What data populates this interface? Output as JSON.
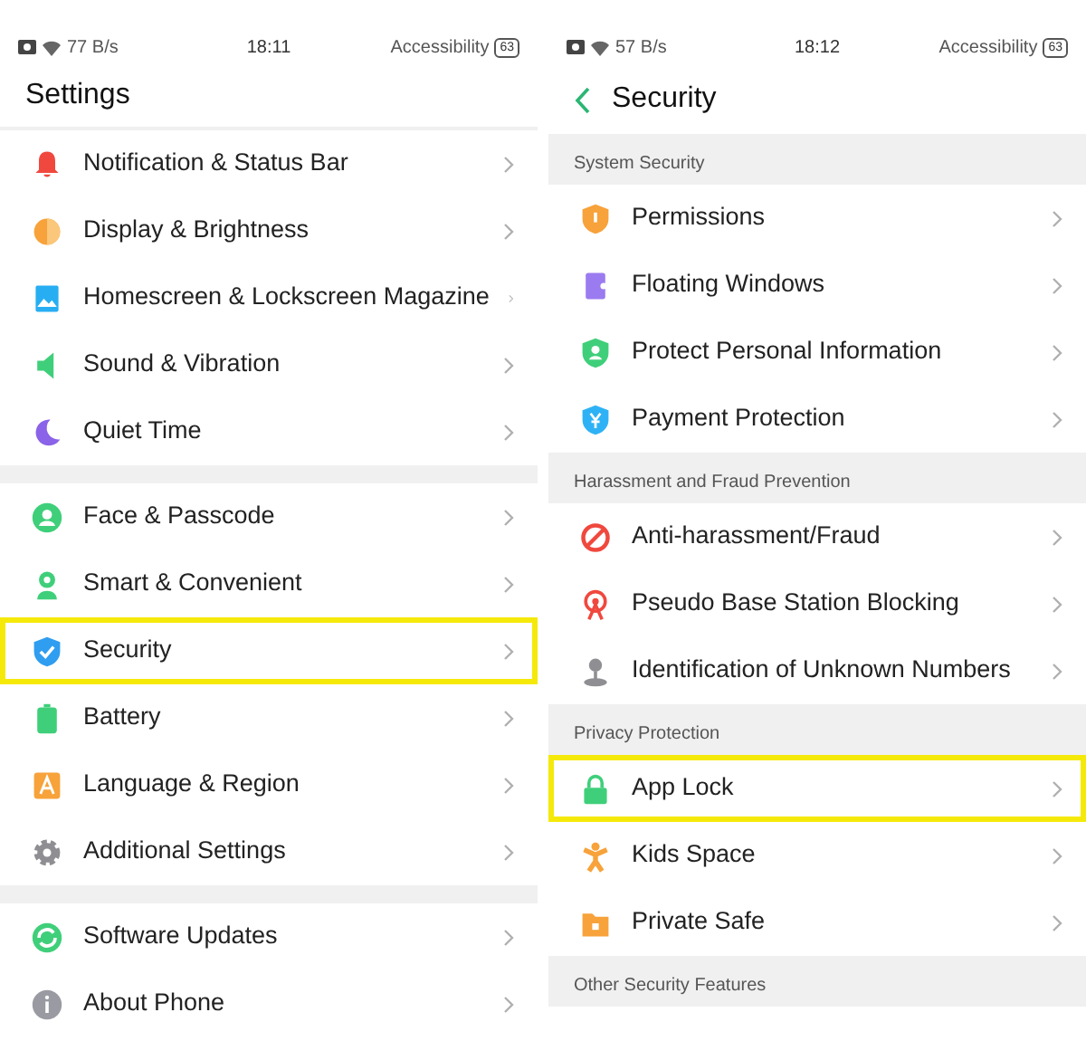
{
  "screens": [
    {
      "status_bar": {
        "speed": "77 B/s",
        "time": "18:11",
        "accessibility": "Accessibility",
        "battery": "63"
      },
      "title": "Settings",
      "back_button": false,
      "groups": [
        {
          "items": [
            {
              "label": "Notification & Status Bar",
              "highlighted": false
            },
            {
              "label": "Display & Brightness",
              "highlighted": false
            },
            {
              "label": "Homescreen & Lockscreen Magazine",
              "highlighted": false
            },
            {
              "label": "Sound & Vibration",
              "highlighted": false
            },
            {
              "label": "Quiet Time",
              "highlighted": false
            }
          ]
        },
        {
          "items": [
            {
              "label": "Face & Passcode",
              "highlighted": false
            },
            {
              "label": "Smart & Convenient",
              "highlighted": false
            },
            {
              "label": "Security",
              "highlighted": true
            },
            {
              "label": "Battery",
              "highlighted": false
            },
            {
              "label": "Language & Region",
              "highlighted": false
            },
            {
              "label": "Additional Settings",
              "highlighted": false
            }
          ]
        },
        {
          "items": [
            {
              "label": "Software Updates",
              "highlighted": false
            },
            {
              "label": "About Phone",
              "highlighted": false
            }
          ]
        }
      ]
    },
    {
      "status_bar": {
        "speed": "57 B/s",
        "time": "18:12",
        "accessibility": "Accessibility",
        "battery": "63"
      },
      "title": "Security",
      "back_button": true,
      "groups": [
        {
          "header": "System Security",
          "items": [
            {
              "label": "Permissions",
              "highlighted": false
            },
            {
              "label": "Floating Windows",
              "highlighted": false
            },
            {
              "label": "Protect Personal Information",
              "highlighted": false
            },
            {
              "label": "Payment Protection",
              "highlighted": false
            }
          ]
        },
        {
          "header": "Harassment and Fraud Prevention",
          "items": [
            {
              "label": "Anti-harassment/Fraud",
              "highlighted": false
            },
            {
              "label": "Pseudo Base Station Blocking",
              "highlighted": false
            },
            {
              "label": "Identification of Unknown Numbers",
              "highlighted": false
            }
          ]
        },
        {
          "header": "Privacy Protection",
          "items": [
            {
              "label": "App Lock",
              "highlighted": true
            },
            {
              "label": "Kids Space",
              "highlighted": false
            },
            {
              "label": "Private Safe",
              "highlighted": false
            }
          ]
        },
        {
          "header": "Other Security Features"
        }
      ]
    }
  ]
}
